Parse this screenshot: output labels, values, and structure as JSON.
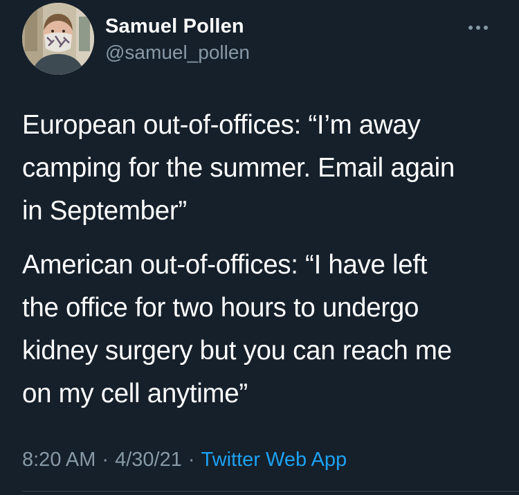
{
  "author": {
    "display_name": "Samuel Pollen",
    "handle": "@samuel_pollen"
  },
  "more_menu_icon": "ellipsis-icon",
  "tweet": {
    "paragraph_1": [
      "European out-of-offices: “I’m away",
      "camping for the summer. Email again",
      "in September”"
    ],
    "paragraph_2": [
      "American out-of-offices: “I have left",
      "the office for two hours to undergo",
      "kidney surgery but you can reach me",
      "on my cell anytime”"
    ]
  },
  "meta": {
    "time": "8:20 AM",
    "separator": "·",
    "date": "4/30/21",
    "source": "Twitter Web App"
  },
  "colors": {
    "background": "#15202b",
    "text_primary": "#ffffff",
    "text_secondary": "#8899a6",
    "accent": "#1da1f2",
    "divider": "#38444d"
  }
}
